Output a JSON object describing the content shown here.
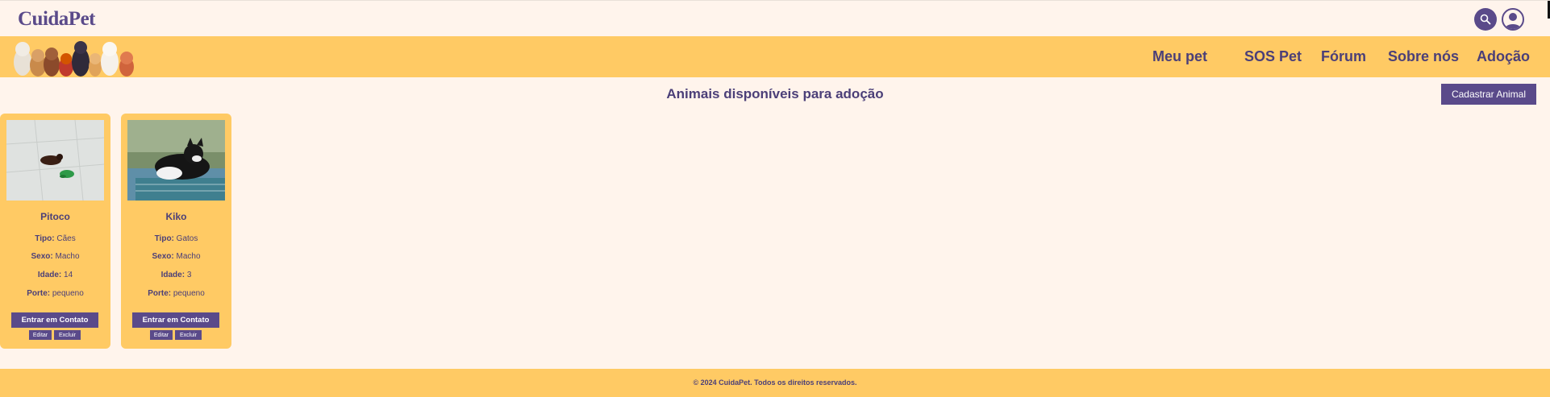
{
  "header": {
    "logo": "CuidaPet",
    "search_icon": "search-icon",
    "user_icon": "user-icon"
  },
  "nav": {
    "items": [
      {
        "label": "Meu pet"
      },
      {
        "label": "SOS Pet"
      },
      {
        "label": "Fórum"
      },
      {
        "label": "Sobre nós"
      },
      {
        "label": "Adoção"
      }
    ]
  },
  "main": {
    "title": "Animais disponíveis para adoção",
    "add_button": "Cadastrar Animal"
  },
  "labels": {
    "tipo": "Tipo:",
    "sexo": "Sexo:",
    "idade": "Idade:",
    "porte": "Porte:",
    "contact": "Entrar em Contato",
    "edit": "Editar",
    "delete": "Excluir"
  },
  "animals": [
    {
      "name": "Pitoco",
      "tipo": "Cães",
      "sexo": "Macho",
      "idade": "14",
      "porte": "pequeno"
    },
    {
      "name": "Kiko",
      "tipo": "Gatos",
      "sexo": "Macho",
      "idade": "3",
      "porte": "pequeno"
    }
  ],
  "footer": {
    "text": "© 2024 CuidaPet. Todos os direitos reservados."
  },
  "colors": {
    "background": "#fff4ec",
    "accent_yellow": "#ffca64",
    "brand_purple": "#5a4a8a"
  }
}
